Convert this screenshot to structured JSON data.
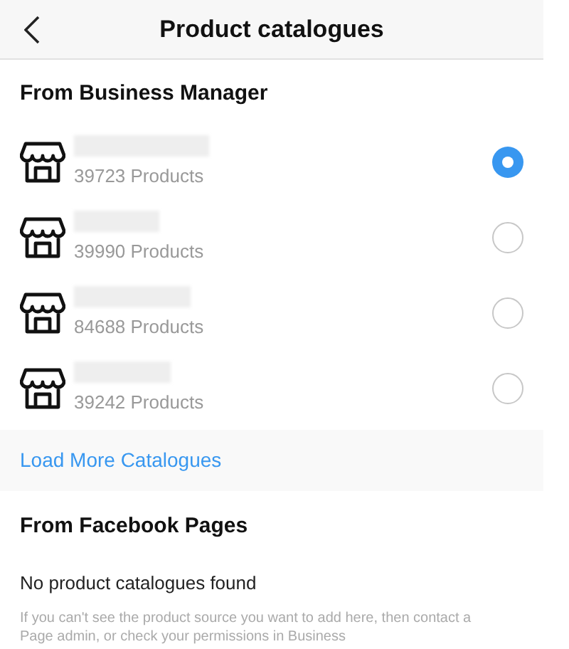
{
  "header": {
    "title": "Product catalogues"
  },
  "business_manager": {
    "heading": "From Business Manager",
    "catalogues": [
      {
        "count": "39723 Products",
        "selected": true
      },
      {
        "count": "39990 Products",
        "selected": false
      },
      {
        "count": "84688 Products",
        "selected": false
      },
      {
        "count": "39242 Products",
        "selected": false
      }
    ],
    "load_more": "Load More Catalogues"
  },
  "facebook_pages": {
    "heading": "From Facebook Pages",
    "empty": "No product catalogues found",
    "help": "If you can't see the product source you want to add here, then contact a Page admin, or check your permissions in Business"
  }
}
